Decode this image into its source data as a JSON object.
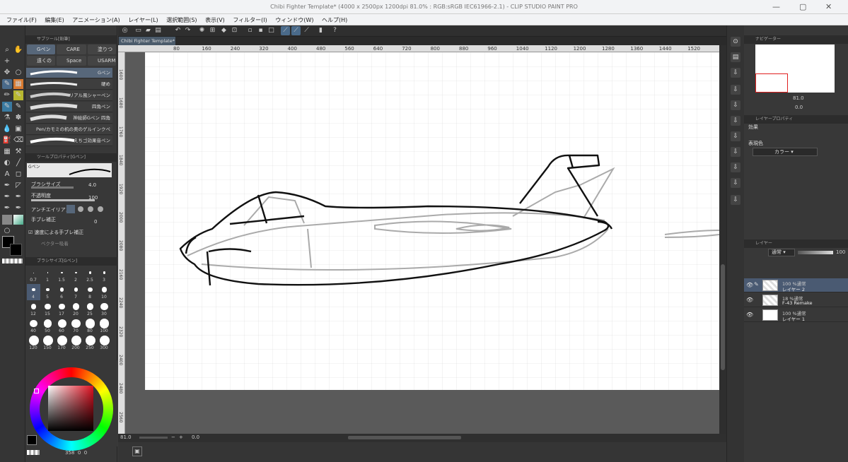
{
  "window": {
    "title": "Chibi Fighter Template* (4000 x 2500px 1200dpi 81.0% : RGB:sRGB IEC61966-2.1) - CLIP STUDIO PAINT PRO"
  },
  "menu": [
    "ファイル(F)",
    "編集(E)",
    "アニメーション(A)",
    "レイヤー(L)",
    "選択範囲(S)",
    "表示(V)",
    "フィルター(I)",
    "ウィンドウ(W)",
    "ヘルプ(H)"
  ],
  "sub_tool": {
    "header": "サブツール[鉛筆]",
    "tabs": [
      "Gペン",
      "CARE",
      "塗りつ",
      "遠くの雲",
      "Space",
      "USARM"
    ],
    "brushes": [
      "Gペン",
      "硬め",
      "リアル風シャーペン",
      "四角ペン",
      "神絵師Gペン 四角",
      "Pen/カモミの机の奥のゲルインクペン",
      "えちゴ効果音ペン"
    ]
  },
  "tool_property": {
    "header": "ツールプロパティ[Gペン]",
    "tool_name": "Gペン",
    "brush_size_label": "ブラシサイズ",
    "brush_size_value": "4.0",
    "opacity_label": "不透明度",
    "opacity_value": "100",
    "antialias_label": "アンチエイリアス",
    "stabilization_label": "手ブレ補正",
    "stabilization_value": "0",
    "speed_stab_label": "速度による手ブレ補正",
    "vector_label": "ベクター吸着"
  },
  "brush_size_panel": {
    "header": "ブラシサイズ[Gペン]",
    "sizes": [
      "0.7",
      "1",
      "1.5",
      "2",
      "2.5",
      "3",
      "4",
      "5",
      "6",
      "7",
      "8",
      "10",
      "12",
      "15",
      "17",
      "20",
      "25",
      "30",
      "40",
      "50",
      "60",
      "70",
      "80",
      "100",
      "120",
      "150",
      "170",
      "200",
      "250",
      "300"
    ]
  },
  "color": {
    "main": "#000000",
    "sub": "#000000",
    "readout": [
      "358",
      "0",
      "0"
    ]
  },
  "document_tab": "Chibi Fighter Template*",
  "ruler_ticks_h": [
    "80",
    "160",
    "240",
    "320",
    "400",
    "480",
    "560",
    "640",
    "720",
    "800",
    "880",
    "960",
    "1040",
    "1120",
    "1200",
    "1280",
    "1360",
    "1440",
    "1520"
  ],
  "ruler_ticks_v": [
    "1600",
    "1680",
    "1760",
    "1840",
    "1920",
    "2000",
    "2080",
    "2160",
    "2240",
    "2320",
    "2400",
    "2480",
    "2560"
  ],
  "status": {
    "zoom": "81.0",
    "angle": "0.0"
  },
  "navigator": {
    "header": "ナビゲーター",
    "zoom": "81.0",
    "angle": "0.0"
  },
  "layer_property": {
    "header": "レイヤープロパティ",
    "effect_label": "効果",
    "expression_label": "表現色",
    "expression_value": "カラー"
  },
  "layers_panel": {
    "header": "レイヤー",
    "blend_mode": "通常",
    "opacity": "100",
    "layers": [
      {
        "opacity_mode": "100 %通常",
        "name": "レイヤー 2",
        "selected": true
      },
      {
        "opacity_mode": "18 %通常",
        "name": "F-43 Remake",
        "selected": false
      },
      {
        "opacity_mode": "100 %通常",
        "name": "レイヤー 1",
        "selected": false
      }
    ]
  }
}
